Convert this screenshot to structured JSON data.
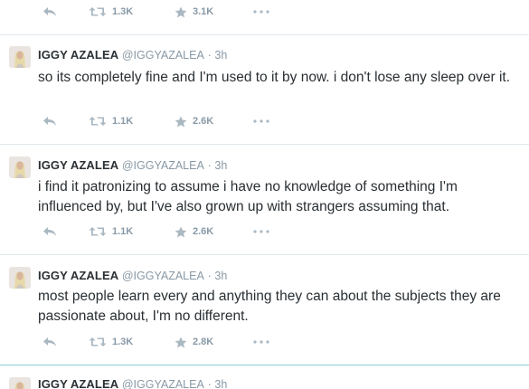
{
  "top_actions": {
    "retweets": "1.3K",
    "favorites": "3.1K"
  },
  "tweets": [
    {
      "name": "IGGY AZALEA",
      "handle": "@IGGYAZALEA",
      "separator": "·",
      "time": "3h",
      "text": "so its completely fine and I'm used to it by now. i don't lose any sleep over it.",
      "retweets": "1.1K",
      "favorites": "2.6K"
    },
    {
      "name": "IGGY AZALEA",
      "handle": "@IGGYAZALEA",
      "separator": "·",
      "time": "3h",
      "text": "i find it patronizing to assume i have no knowledge of something I'm influenced by, but I've also grown up with strangers assuming that.",
      "retweets": "1.1K",
      "favorites": "2.6K"
    },
    {
      "name": "IGGY AZALEA",
      "handle": "@IGGYAZALEA",
      "separator": "·",
      "time": "3h",
      "text": "most people learn every and anything they can about the subjects they are passionate about, I'm no different.",
      "retweets": "1.3K",
      "favorites": "2.8K"
    },
    {
      "name": "IGGY AZALEA",
      "handle": "@IGGYAZALEA",
      "separator": "·",
      "time": "3h"
    }
  ],
  "icons": {
    "reply": "reply-icon",
    "retweet": "retweet-icon",
    "favorite": "star-icon",
    "more": "more-icon"
  },
  "colors": {
    "text": "#292f33",
    "muted": "#8899a6",
    "divider": "#e1e8ed",
    "focus_divider": "#88c9d6"
  }
}
